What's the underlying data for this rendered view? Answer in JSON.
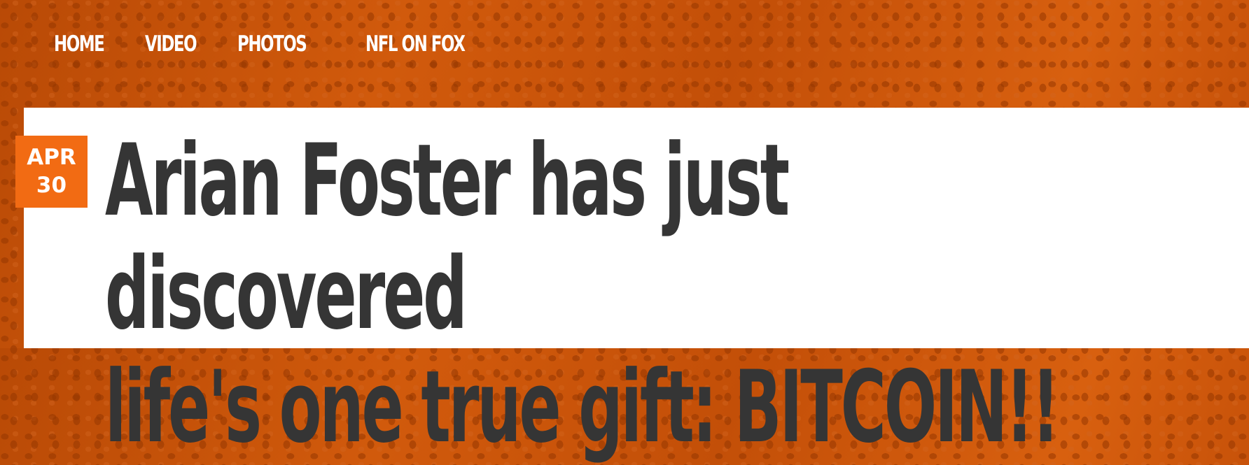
{
  "nav": {
    "items": [
      {
        "label": "HOME"
      },
      {
        "label": "VIDEO"
      },
      {
        "label": "PHOTOS"
      },
      {
        "label": "NFL ON FOX"
      }
    ]
  },
  "article": {
    "date": {
      "month": "APR",
      "day": "30"
    },
    "headline_line1": "Arian Foster has just discovered",
    "headline_line2": "life's one true gift: BITCOIN!!"
  },
  "colors": {
    "header_background": "#c55009",
    "date_badge": "#f26b13",
    "headline_text": "#353535",
    "nav_text": "#ffffff"
  }
}
